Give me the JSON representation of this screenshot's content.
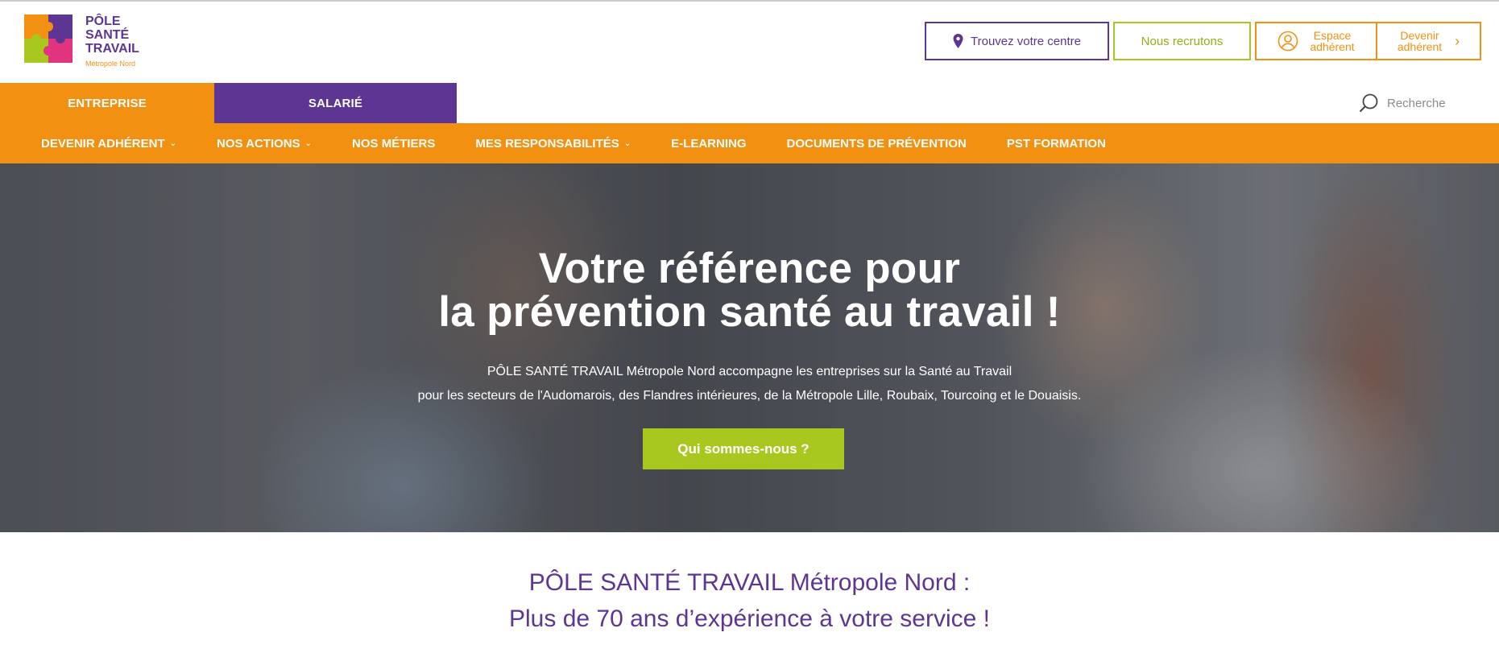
{
  "brand": {
    "line1": "PÔLE",
    "line2": "SANTÉ",
    "line3": "TRAVAIL",
    "sub": "Métropole Nord",
    "colors": {
      "orange": "#f29111",
      "purple": "#5c3692",
      "green": "#a8c820",
      "pink": "#e0347e"
    }
  },
  "header": {
    "find_centre": "Trouvez votre centre",
    "recruit": "Nous recrutons",
    "member_area_l1": "Espace",
    "member_area_l2": "adhérent",
    "become_member_l1": "Devenir",
    "become_member_l2": "adhérent",
    "icons": {
      "find_centre": "map-pin-icon",
      "member_area": "user-circle-icon",
      "become_member": "chevron-right-icon"
    }
  },
  "tabs": [
    {
      "label": "ENTREPRISE",
      "active": true
    },
    {
      "label": "SALARIÉ",
      "active": false
    }
  ],
  "search": {
    "placeholder": "Recherche",
    "icon": "search-icon"
  },
  "nav": [
    {
      "label": "DEVENIR ADHÉRENT",
      "dropdown": true
    },
    {
      "label": "NOS ACTIONS",
      "dropdown": true
    },
    {
      "label": "NOS MÉTIERS",
      "dropdown": false
    },
    {
      "label": "MES RESPONSABILITÉS",
      "dropdown": true
    },
    {
      "label": "E-LEARNING",
      "dropdown": false
    },
    {
      "label": "DOCUMENTS DE PRÉVENTION",
      "dropdown": false
    },
    {
      "label": "PST FORMATION",
      "dropdown": false
    }
  ],
  "hero": {
    "title_line1": "Votre référence pour",
    "title_line2": "la prévention santé au travail !",
    "sub_line1": "PÔLE SANTÉ TRAVAIL Métropole Nord accompagne les entreprises sur la Santé au Travail",
    "sub_line2": "pour les secteurs de l'Audomarois, des Flandres intérieures, de la Métropole Lille, Roubaix, Tourcoing et le Douaisis.",
    "cta": "Qui sommes-nous ?"
  },
  "intro": {
    "line1": "PÔLE SANTÉ TRAVAIL Métropole Nord :",
    "line2": "Plus de 70 ans d’expérience à votre service !"
  }
}
